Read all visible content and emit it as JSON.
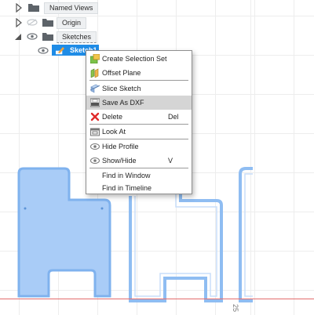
{
  "browser": {
    "named_views_label": "Named Views",
    "origin_label": "Origin",
    "sketches_label": "Sketches",
    "sketch_label": "Sketch1"
  },
  "context_menu": {
    "items": [
      {
        "label": "Create Selection Set",
        "icon": "selection-set-icon",
        "shortcut": ""
      },
      {
        "label": "Offset Plane",
        "icon": "offset-plane-icon",
        "shortcut": ""
      },
      {
        "label": "Slice Sketch",
        "icon": "slice-sketch-icon",
        "shortcut": ""
      },
      {
        "label": "Save As DXF",
        "icon": "dxf-file-icon",
        "shortcut": "",
        "highlighted": true
      },
      {
        "label": "Delete",
        "icon": "delete-x-icon",
        "shortcut": "Del"
      },
      {
        "label": "Look At",
        "icon": "look-at-icon",
        "shortcut": ""
      },
      {
        "label": "Hide Profile",
        "icon": "eye-icon",
        "shortcut": ""
      },
      {
        "label": "Show/Hide",
        "icon": "eye-icon",
        "shortcut": "V"
      },
      {
        "label": "Find in Window",
        "icon": "",
        "shortcut": ""
      },
      {
        "label": "Find in Timeline",
        "icon": "",
        "shortcut": ""
      }
    ]
  },
  "canvas": {
    "ruler_value": "25",
    "colors": {
      "profile_fill": "#a9ccf7",
      "profile_stroke": "#7fb2ee",
      "selection_blue": "#1f8ce6",
      "axis_red": "#e46b6b",
      "menu_highlight": "#d5d5d5"
    }
  }
}
